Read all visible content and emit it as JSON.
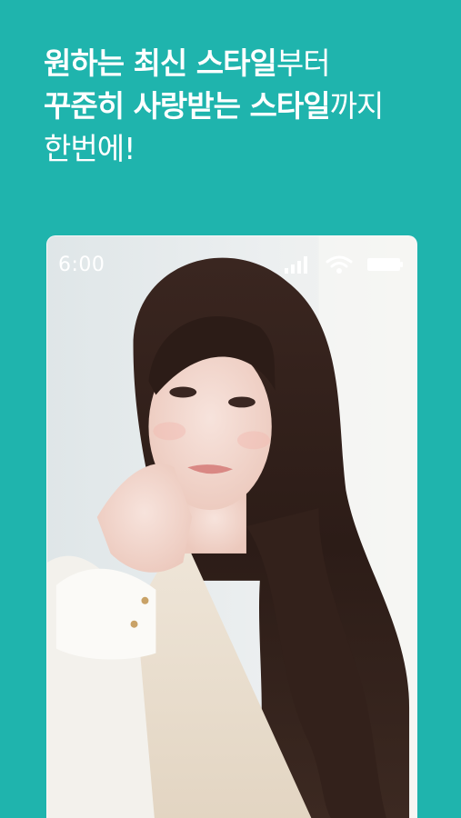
{
  "headline": {
    "line1_bold": "원하는 최신 스타일",
    "line1_light": "부터",
    "line2_bold": "꾸준히 사랑받는 스타일",
    "line2_light": "까지",
    "line3": "한번에!"
  },
  "phone": {
    "status_time": "6:00",
    "icons": [
      "signal-icon",
      "wifi-icon",
      "battery-icon"
    ]
  },
  "colors": {
    "background": "#1fb4ad",
    "text": "#ffffff"
  }
}
